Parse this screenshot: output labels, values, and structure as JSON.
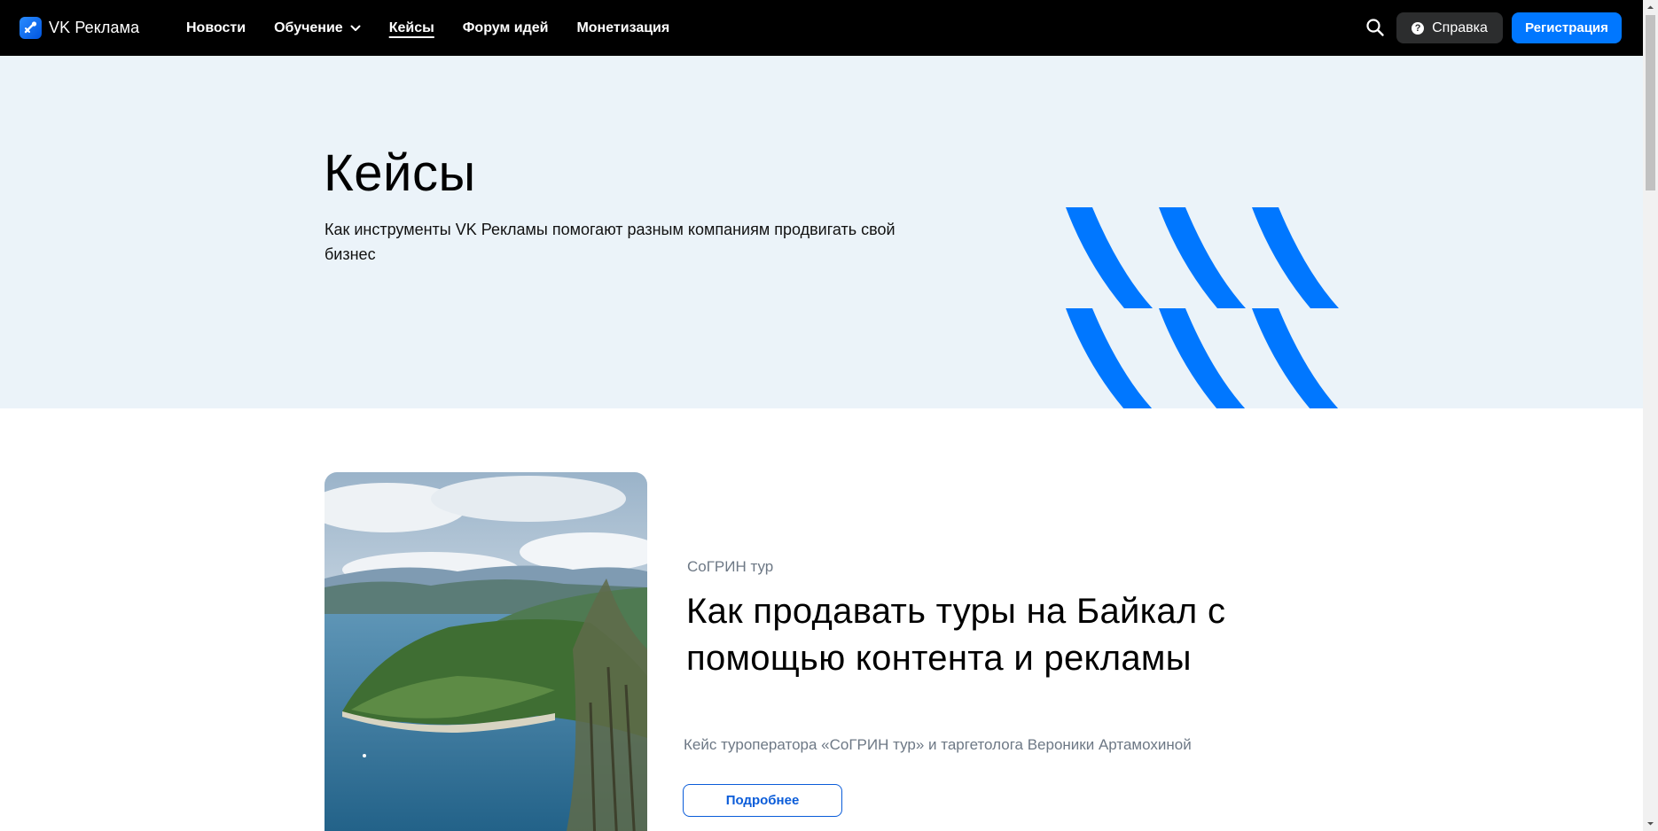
{
  "header": {
    "logo_text": "VK Реклама",
    "nav": [
      {
        "label": "Новости",
        "active": false
      },
      {
        "label": "Обучение",
        "active": false,
        "has_dropdown": true
      },
      {
        "label": "Кейсы",
        "active": true
      },
      {
        "label": "Форум идей",
        "active": false
      },
      {
        "label": "Монетизация",
        "active": false
      }
    ],
    "help_label": "Справка",
    "register_label": "Регистрация",
    "colors": {
      "bar": "#000000",
      "accent": "#0077ff",
      "help_bg": "#2c2d2e"
    }
  },
  "hero": {
    "title": "Кейсы",
    "subtitle": "Как инструменты VK Рекламы помогают разным компаниям продвигать свой бизнес",
    "background": "#ebf3f9",
    "art_color": "#0077ff"
  },
  "case": {
    "company": "СоГРИН тур",
    "title": "Как продавать туры на Байкал с помощью контента и рекламы",
    "description": "Кейс туроператора «СоГРИН тур» и таргетолога Вероники Артамохиной",
    "more_label": "Подробнее",
    "image": "lake-baikal-photo"
  }
}
